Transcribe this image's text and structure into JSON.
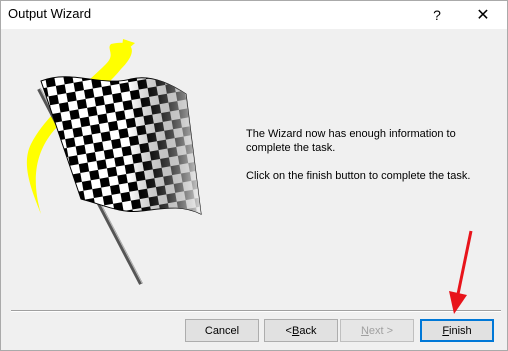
{
  "window": {
    "title": "Output Wizard"
  },
  "titlebar": {
    "help_glyph": "?",
    "close_glyph": "✕"
  },
  "graphic": {
    "name": "checkered-flag",
    "accent_color": "#ffff00"
  },
  "message": {
    "line1": "The Wizard now has enough information to complete the task.",
    "line2": "Click on the finish button to complete the task."
  },
  "buttons": {
    "cancel": "Cancel",
    "back_prefix": "< ",
    "back_key": "B",
    "back_rest": "ack",
    "next_key": "N",
    "next_rest": "ext >",
    "finish_key": "F",
    "finish_rest": "inish"
  },
  "annotation": {
    "arrow_color": "#e8141b"
  }
}
